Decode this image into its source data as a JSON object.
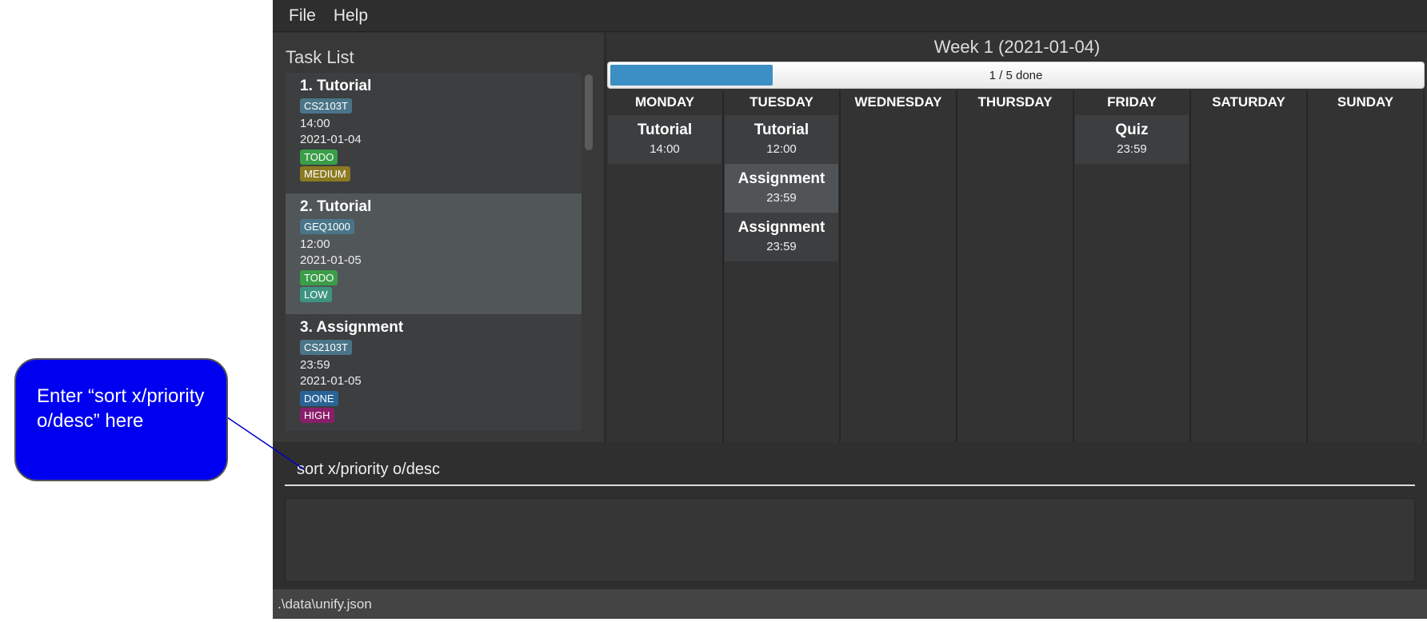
{
  "menu": {
    "file": "File",
    "help": "Help"
  },
  "task_list": {
    "title": "Task List",
    "tasks": [
      {
        "name": "1.  Tutorial",
        "module": "CS2103T",
        "time": "14:00",
        "date": "2021-01-04",
        "status": "TODO",
        "priority": "MEDIUM",
        "selected": false
      },
      {
        "name": "2.  Tutorial",
        "module": "GEQ1000",
        "time": "12:00",
        "date": "2021-01-05",
        "status": "TODO",
        "priority": "LOW",
        "selected": true
      },
      {
        "name": "3.  Assignment",
        "module": "CS2103T",
        "time": "23:59",
        "date": "2021-01-05",
        "status": "DONE",
        "priority": "HIGH",
        "selected": false
      }
    ]
  },
  "calendar": {
    "week_title": "Week 1 (2021-01-04)",
    "progress_label": "1 / 5 done",
    "progress_fraction": 0.2,
    "days": [
      {
        "name": "MONDAY",
        "events": [
          {
            "name": "Tutorial",
            "time": "14:00"
          }
        ]
      },
      {
        "name": "TUESDAY",
        "events": [
          {
            "name": "Tutorial",
            "time": "12:00"
          },
          {
            "name": "Assignment",
            "time": "23:59"
          },
          {
            "name": "Assignment",
            "time": "23:59"
          }
        ]
      },
      {
        "name": "WEDNESDAY",
        "events": []
      },
      {
        "name": "THURSDAY",
        "events": []
      },
      {
        "name": "FRIDAY",
        "events": [
          {
            "name": "Quiz",
            "time": "23:59"
          }
        ]
      },
      {
        "name": "SATURDAY",
        "events": []
      },
      {
        "name": "SUNDAY",
        "events": []
      }
    ]
  },
  "command": {
    "value": "sort x/priority o/desc"
  },
  "result": {
    "text": ""
  },
  "status_bar": {
    "path": ".\\data\\unify.json"
  },
  "callout": {
    "text": "Enter “sort x/priority o/desc” here"
  },
  "colors": {
    "module": "#4a7588",
    "TODO": "#3a9e48",
    "DONE": "#2a6496",
    "MEDIUM": "#8c7a22",
    "LOW": "#3e9480",
    "HIGH": "#8a1e6a",
    "progress": "#3c8fc4",
    "callout": "#0000f0"
  }
}
